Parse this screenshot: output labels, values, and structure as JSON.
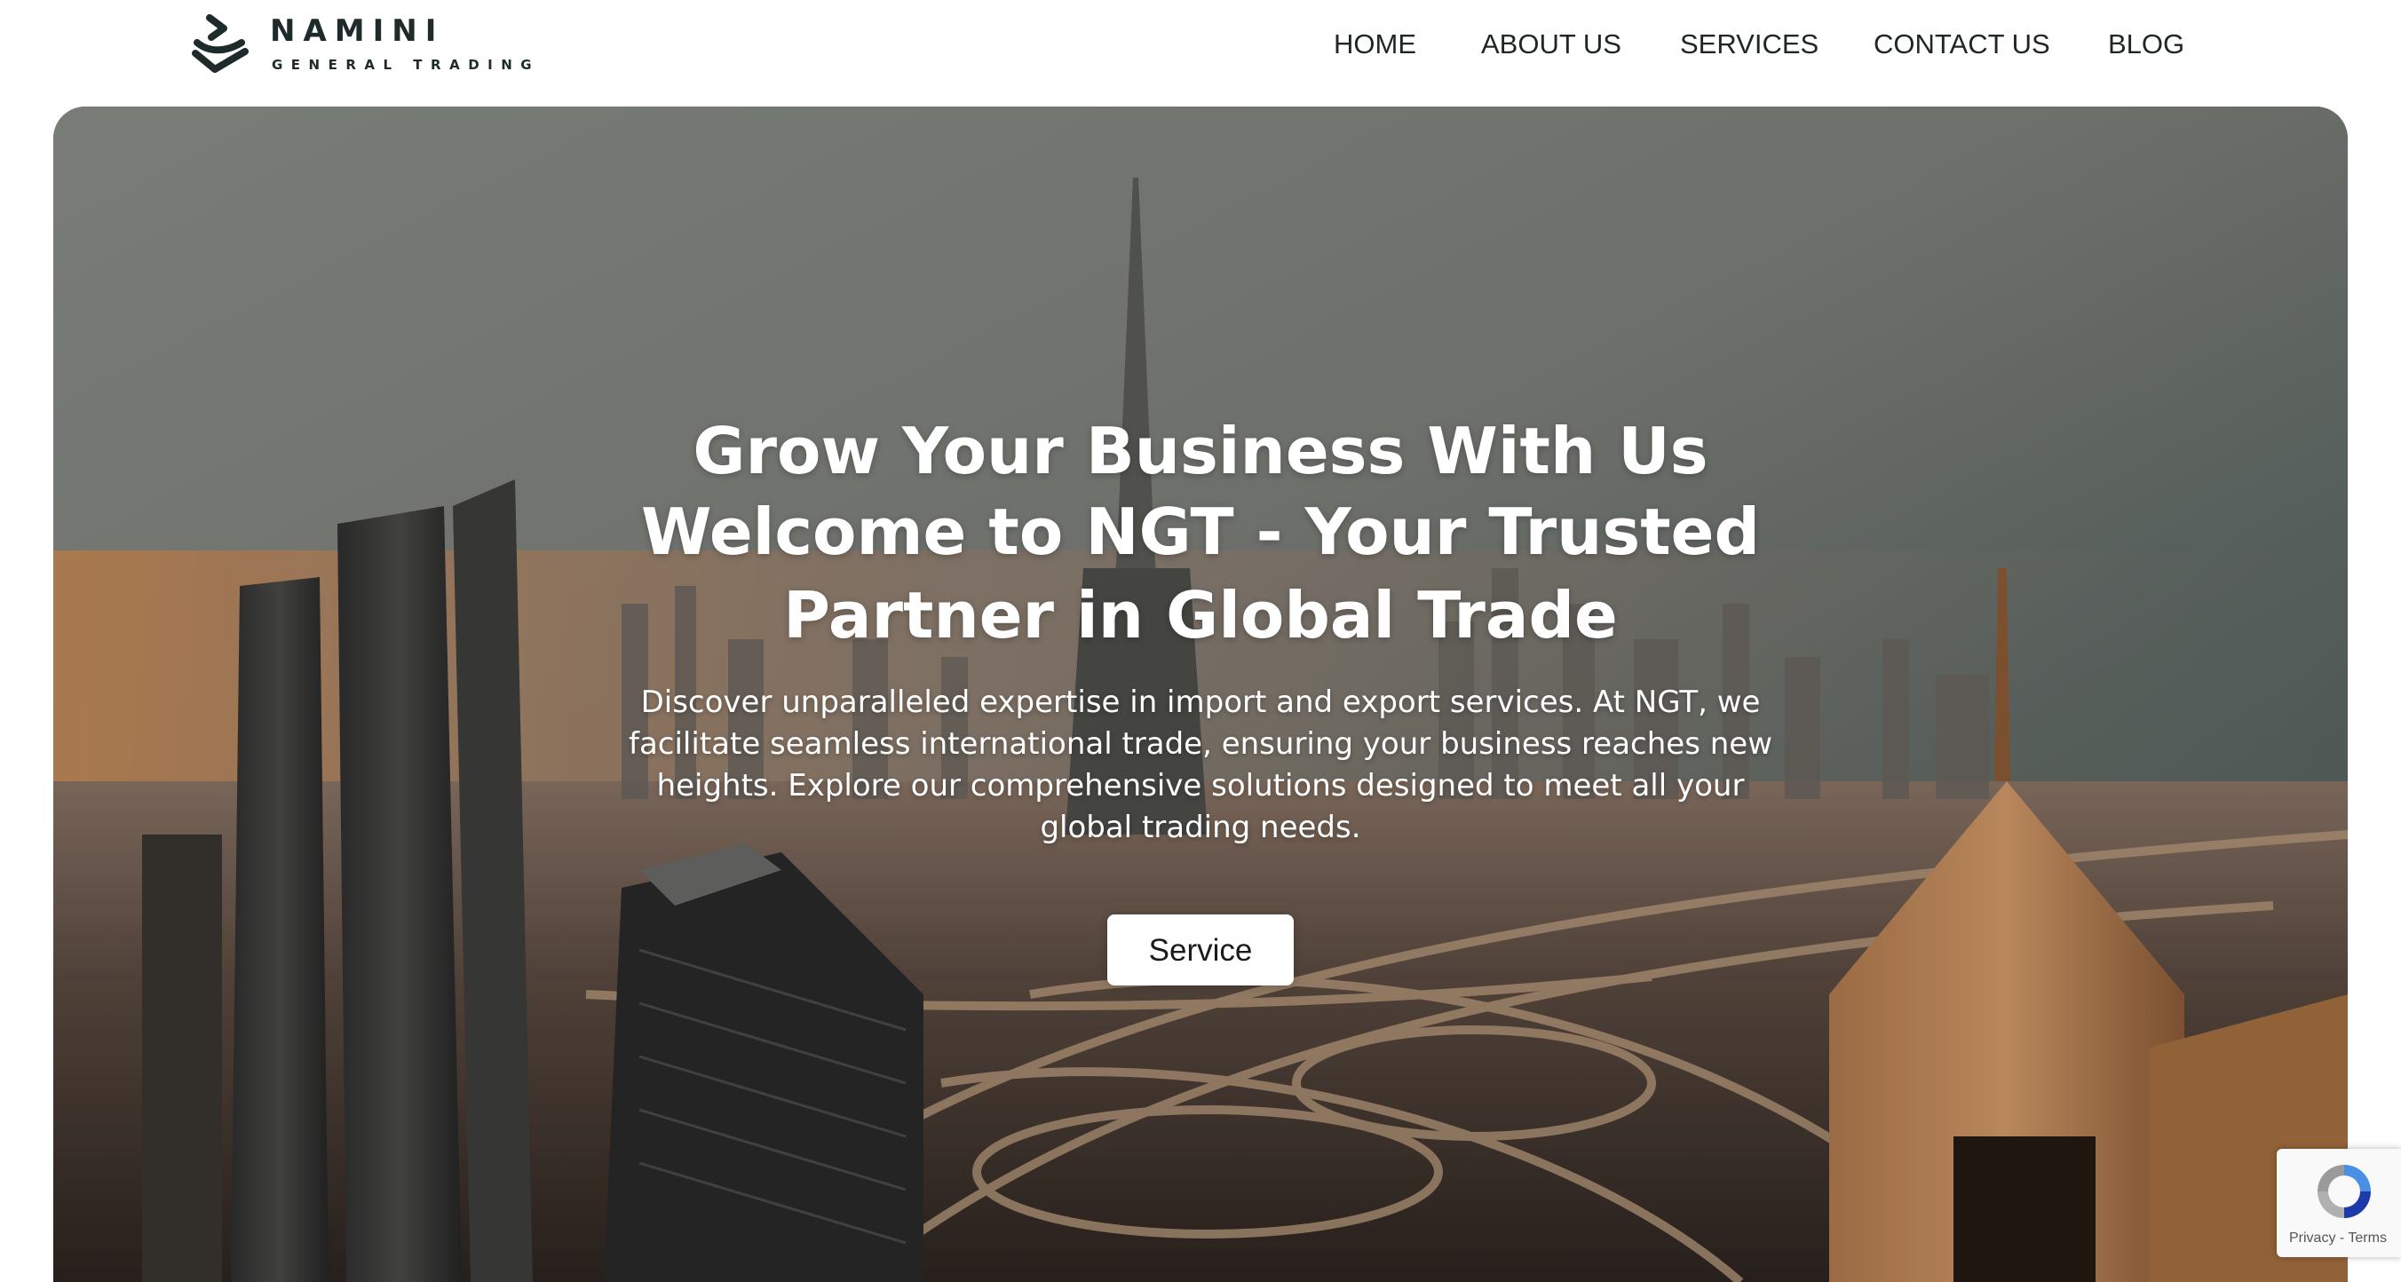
{
  "brand": {
    "name": "NAMINI",
    "subtitle": "GENERAL TRADING"
  },
  "nav": {
    "items": [
      {
        "label": "HOME"
      },
      {
        "label": "ABOUT US"
      },
      {
        "label": "SERVICES"
      },
      {
        "label": "CONTACT US"
      },
      {
        "label": "BLOG"
      }
    ]
  },
  "hero": {
    "title_line1": "Grow Your Business With Us",
    "title_line2": "Welcome to NGT - Your Trusted Partner in Global Trade",
    "description": "Discover unparalleled expertise in import and export services. At NGT, we facilitate seamless international trade, ensuring your business reaches new heights. Explore our comprehensive solutions designed to meet all your global trading needs.",
    "button_label": "Service",
    "background_image": "city-skyline-highway-interchange"
  },
  "recaptcha": {
    "icon": "recaptcha-icon",
    "links": "Privacy - Terms"
  },
  "colors": {
    "text_dark": "#1e2626",
    "hero_text": "#ffffff",
    "button_bg": "#ffffff"
  }
}
